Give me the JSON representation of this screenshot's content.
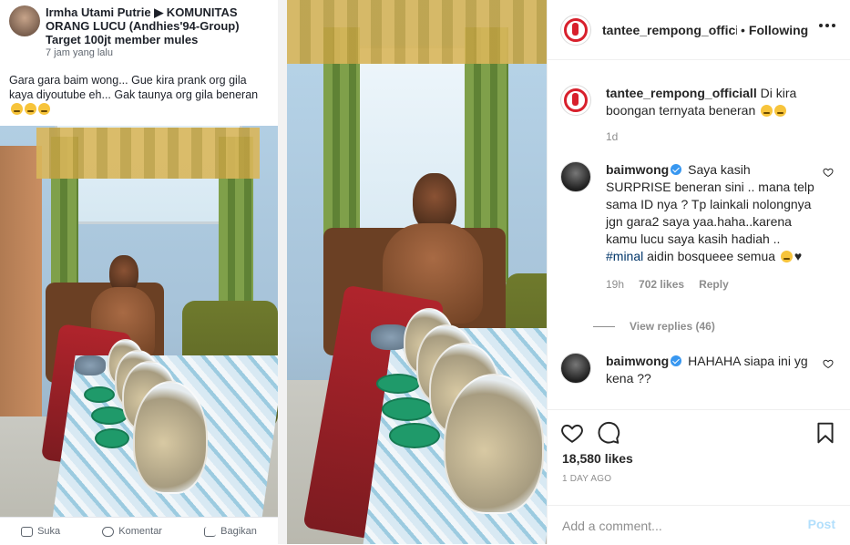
{
  "media": {
    "fb_post": {
      "author_line": "Irmha Utami Putrie ▶ KOMUNITAS ORANG LUCU (Andhies'94-Group) Target 100jt member mules",
      "time": "7 jam yang lalu",
      "text": "Gara gara baim wong... Gue kira prank org gila kaya diyoutube eh... Gak taunya org gila beneran",
      "actions": [
        "Suka",
        "Komentar",
        "Bagikan"
      ]
    }
  },
  "header": {
    "username": "tantee_rempong_officiall",
    "separator": "•",
    "follow_status": "Following"
  },
  "comments": [
    {
      "user": "tantee_rempong_officiall",
      "text": "Di kira boongan ternyata beneran",
      "time": "1d"
    },
    {
      "user": "baimwong",
      "verified": true,
      "text_before": "Saya kasih SURPRISE beneran sini .. mana telp sama ID nya ? Tp lainkali nolongnya jgn gara2 saya yaa.haha..karena kamu lucu saya kasih hadiah .. ",
      "hashtag": "#minal",
      "text_after": " aidin bosqueee semua",
      "time": "19h",
      "likes": "702 likes",
      "reply": "Reply",
      "view_replies": "View replies (46)"
    },
    {
      "user": "baimwong",
      "verified": true,
      "text": "HAHAHA siapa ini yg kena ??"
    }
  ],
  "actions": {
    "likes": "18,580 likes",
    "age": "1 DAY AGO"
  },
  "add_comment": {
    "placeholder": "Add a comment...",
    "post_label": "Post"
  },
  "colors": {
    "link_blue": "#003569",
    "verified_blue": "#3897f0",
    "post_disabled": "#b2dffc",
    "muted": "#8e8e8e",
    "brand_red": "#d8202c"
  }
}
